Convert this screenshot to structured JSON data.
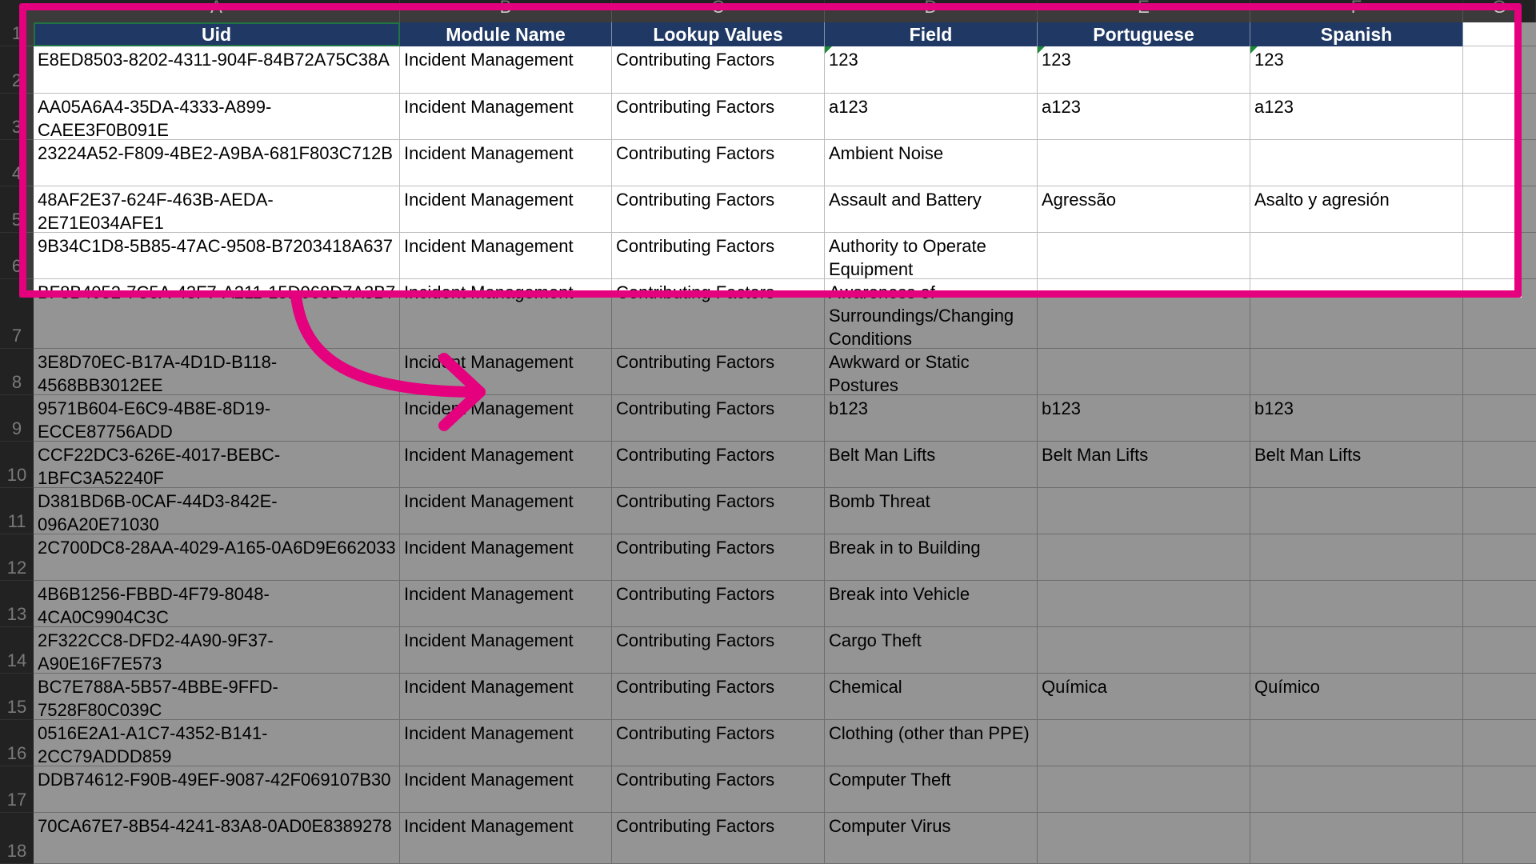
{
  "column_letters": [
    "A",
    "B",
    "C",
    "D",
    "E",
    "F",
    "G"
  ],
  "headers": [
    "Uid",
    "Module  Name",
    "Lookup  Values",
    "Field",
    "Portuguese",
    "Spanish"
  ],
  "rows": [
    {
      "num": "2",
      "uid": "E8ED8503-8202-4311-904F-84B72A75C38A",
      "module": "Incident Management",
      "lookup": "Contributing Factors",
      "field": "123",
      "portuguese": "123",
      "spanish": "123"
    },
    {
      "num": "3",
      "uid": "AA05A6A4-35DA-4333-A899-CAEE3F0B091E",
      "module": "Incident Management",
      "lookup": "Contributing Factors",
      "field": "a123",
      "portuguese": "a123",
      "spanish": "a123"
    },
    {
      "num": "4",
      "uid": "23224A52-F809-4BE2-A9BA-681F803C712B",
      "module": "Incident Management",
      "lookup": "Contributing Factors",
      "field": "Ambient Noise",
      "portuguese": "",
      "spanish": ""
    },
    {
      "num": "5",
      "uid": "48AF2E37-624F-463B-AEDA-2E71E034AFE1",
      "module": "Incident Management",
      "lookup": "Contributing Factors",
      "field": "Assault and Battery",
      "portuguese": "Agressão",
      "spanish": "Asalto y agresión"
    },
    {
      "num": "6",
      "uid": "9B34C1D8-5B85-47AC-9508-B7203418A637",
      "module": "Incident Management",
      "lookup": "Contributing Factors",
      "field": "Authority to Operate Equipment",
      "portuguese": "",
      "spanish": ""
    },
    {
      "num": "7",
      "uid": "BF8B4052-7C5A-43F7-A211-15D068D7A3B7",
      "module": "Incident Management",
      "lookup": "Contributing Factors",
      "field": "Awareness of Surroundings/Changing Conditions",
      "portuguese": "",
      "spanish": ""
    },
    {
      "num": "8",
      "uid": "3E8D70EC-B17A-4D1D-B118-4568BB3012EE",
      "module": "Incident Management",
      "lookup": "Contributing Factors",
      "field": "Awkward or Static Postures",
      "portuguese": "",
      "spanish": ""
    },
    {
      "num": "9",
      "uid": "9571B604-E6C9-4B8E-8D19-ECCE87756ADD",
      "module": "Incident Management",
      "lookup": "Contributing Factors",
      "field": "b123",
      "portuguese": "b123",
      "spanish": "b123"
    },
    {
      "num": "10",
      "uid": "CCF22DC3-626E-4017-BEBC-1BFC3A52240F",
      "module": "Incident Management",
      "lookup": "Contributing Factors",
      "field": "Belt Man Lifts",
      "portuguese": "Belt Man Lifts",
      "spanish": "Belt Man Lifts"
    },
    {
      "num": "11",
      "uid": "D381BD6B-0CAF-44D3-842E-096A20E71030",
      "module": "Incident Management",
      "lookup": "Contributing Factors",
      "field": "Bomb Threat",
      "portuguese": "",
      "spanish": ""
    },
    {
      "num": "12",
      "uid": "2C700DC8-28AA-4029-A165-0A6D9E662033",
      "module": "Incident Management",
      "lookup": "Contributing Factors",
      "field": "Break in to Building",
      "portuguese": "",
      "spanish": ""
    },
    {
      "num": "13",
      "uid": "4B6B1256-FBBD-4F79-8048-4CA0C9904C3C",
      "module": "Incident Management",
      "lookup": "Contributing Factors",
      "field": "Break into Vehicle",
      "portuguese": "",
      "spanish": ""
    },
    {
      "num": "14",
      "uid": "2F322CC8-DFD2-4A90-9F37-A90E16F7E573",
      "module": "Incident Management",
      "lookup": "Contributing Factors",
      "field": "Cargo Theft",
      "portuguese": "",
      "spanish": ""
    },
    {
      "num": "15",
      "uid": "BC7E788A-5B57-4BBE-9FFD-7528F80C039C",
      "module": "Incident Management",
      "lookup": "Contributing Factors",
      "field": "Chemical",
      "portuguese": "Química",
      "spanish": "Químico"
    },
    {
      "num": "16",
      "uid": "0516E2A1-A1C7-4352-B141-2CC79ADDD859",
      "module": "Incident Management",
      "lookup": "Contributing Factors",
      "field": "Clothing (other than PPE)",
      "portuguese": "",
      "spanish": ""
    },
    {
      "num": "17",
      "uid": "DDB74612-F90B-49EF-9087-42F069107B30",
      "module": "Incident Management",
      "lookup": "Contributing Factors",
      "field": "Computer Theft",
      "portuguese": "",
      "spanish": ""
    },
    {
      "num": "18",
      "uid": "70CA67E7-8B54-4241-83A8-0AD0E8389278",
      "module": "Incident Management",
      "lookup": "Contributing Factors",
      "field": "Computer Virus",
      "portuguese": "",
      "spanish": ""
    }
  ],
  "header_row_num": "1",
  "colors": {
    "header_bg": "#1f3864",
    "highlight": "#e5007e",
    "indicator": "#1d8a3a"
  },
  "annotation": {
    "highlight_box": "pink-rectangle",
    "arrow": "pink-curved-arrow"
  }
}
